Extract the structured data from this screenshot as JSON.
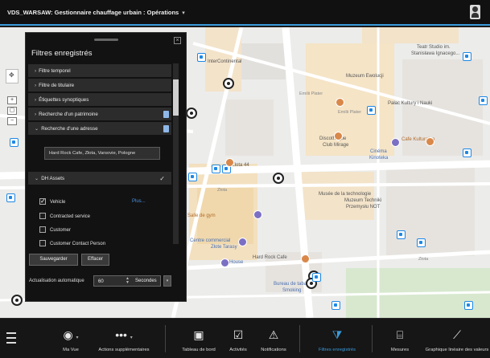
{
  "app": {
    "title": "VDS_WARSAW: Gestionnaire chauffage urbain : Opérations",
    "title_caret": "▾"
  },
  "map": {
    "labels": [
      "Teatr Studio im.",
      "Stanisława Ignacego...",
      "InterContinental",
      "Muzeum Ewolucji",
      "Pałac Kultury i Nauki",
      "Emilii Plater",
      "Discothèque",
      "Club Mirage",
      "Cinéma",
      "Kinoteka",
      "Cafe Kulturalna",
      "Zlota 44",
      "Musée de la technologie",
      "Muzeum Techniki",
      "Przemysłu NOT",
      "Salle de gym",
      "Centre commercial",
      "Złote Tarasy",
      "House",
      "Hard Rock Cafe",
      "Bureau de tabac",
      "Smoking",
      "Złota",
      "Złota",
      "Emilii Plater"
    ]
  },
  "panel": {
    "title": "Filtres enregistrés",
    "close_icon": "×",
    "rows": [
      {
        "label": "Filtre temporel",
        "arrow": "›"
      },
      {
        "label": "Filtre de titulaire",
        "arrow": "›"
      },
      {
        "label": "Étiquettes synoptiques",
        "arrow": "›"
      },
      {
        "label": "Recherche d'un patrimoine",
        "arrow": "›"
      },
      {
        "label": "Recherche d'une adresse",
        "arrow": "⌄"
      }
    ],
    "address_value": "Hard Rock Cafe, Złota, Varsovie, Pologne",
    "dh_assets": {
      "label": "DH Assets",
      "arrow": "⌄",
      "check": "✓"
    },
    "checkboxes": [
      {
        "label": "Vehicle",
        "checked": true
      },
      {
        "label": "Contracted service",
        "checked": false
      },
      {
        "label": "Customer",
        "checked": false
      },
      {
        "label": "Customer Contact Person",
        "checked": false
      }
    ],
    "plus_link": "Plus...",
    "save_button": "Sauvegarder",
    "clear_button": "Effacer",
    "auto_refresh_label": "Actualisation automatique",
    "auto_refresh_value": "60",
    "auto_refresh_unit": "Secondes",
    "unit_caret": "▾"
  },
  "toolbar": {
    "items": [
      {
        "label": "Ma Vue",
        "icon": "◉",
        "caret": "▾"
      },
      {
        "label": "Actions supplémentaires",
        "icon": "•••",
        "caret": "▾"
      },
      {
        "label": "Tableau de bord",
        "icon": "▣"
      },
      {
        "label": "Activités",
        "icon": "☑"
      },
      {
        "label": "Notifications",
        "icon": "⚠"
      },
      {
        "label": "Filtres enregistrés",
        "icon": "⧩",
        "active": true
      },
      {
        "label": "Mesures",
        "icon": "⌸"
      },
      {
        "label": "Graphique linéaire des valeurs",
        "icon": "⟋"
      }
    ]
  },
  "colors": {
    "accent": "#3a9ad9",
    "panel_bg": "#121212",
    "topbar_bg": "#111111"
  }
}
